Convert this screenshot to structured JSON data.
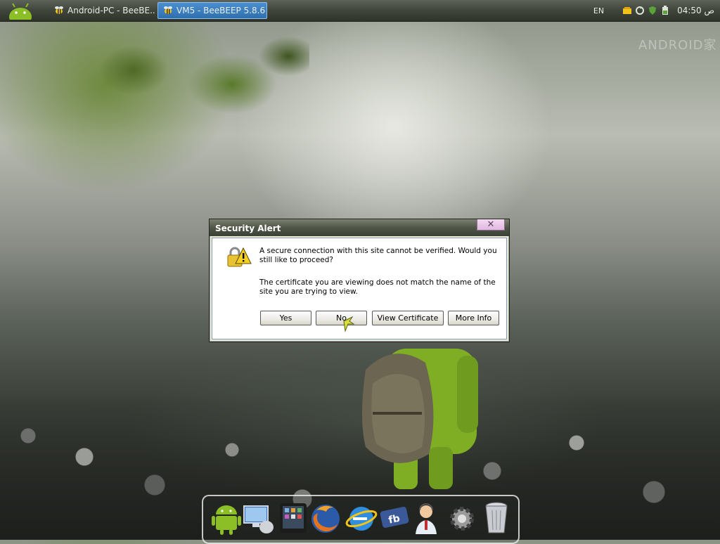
{
  "taskbar": {
    "tasks": [
      {
        "label": "Android-PC - BeeBE...",
        "active": false,
        "icon": "bee-icon"
      },
      {
        "label": "VM5 - BeeBEEP 5.8.6",
        "active": true,
        "icon": "bee-icon"
      }
    ],
    "tray": {
      "language": "EN",
      "icons": [
        "network-icon",
        "update-icon",
        "antivirus-icon",
        "battery-icon"
      ],
      "clock": "04:50 ص"
    }
  },
  "watermark": "ANDROID家",
  "dialog": {
    "title": "Security Alert",
    "close_glyph": "✕",
    "message1": "A secure connection with this site cannot be verified. Would you still like to proceed?",
    "message2": "The certificate you are viewing does not match the name of the site you are trying to view.",
    "buttons": {
      "yes": "Yes",
      "no": "No",
      "view_certificate": "View Certificate",
      "more_info": "More Info"
    }
  },
  "dock": {
    "items": [
      "android-icon",
      "computer-icon",
      "tablet-icon",
      "firefox-icon",
      "internet-explorer-icon",
      "facebook-icon",
      "support-agent-icon",
      "settings-gear-icon",
      "trash-can-icon"
    ]
  },
  "colors": {
    "active_task": "#2f6fae",
    "dialog_bg": "#ece9d8",
    "android_green": "#8cbf26"
  }
}
